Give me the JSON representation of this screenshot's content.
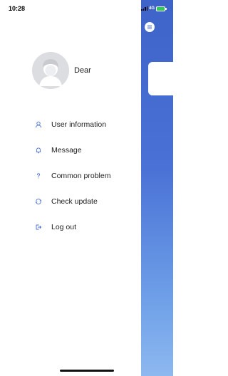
{
  "status_bar": {
    "time": "10:28",
    "network": "4G"
  },
  "profile": {
    "name": "Dear"
  },
  "menu": {
    "items": [
      {
        "label": "User information",
        "icon": "user-icon"
      },
      {
        "label": "Message",
        "icon": "bell-icon"
      },
      {
        "label": "Common problem",
        "icon": "question-icon"
      },
      {
        "label": "Check update",
        "icon": "refresh-icon"
      },
      {
        "label": "Log out",
        "icon": "logout-icon"
      }
    ]
  },
  "colors": {
    "accent": "#4a6fd1",
    "background_gradient_top": "#3e63c9",
    "background_gradient_bottom": "#8db8f0",
    "battery": "#34c759"
  }
}
